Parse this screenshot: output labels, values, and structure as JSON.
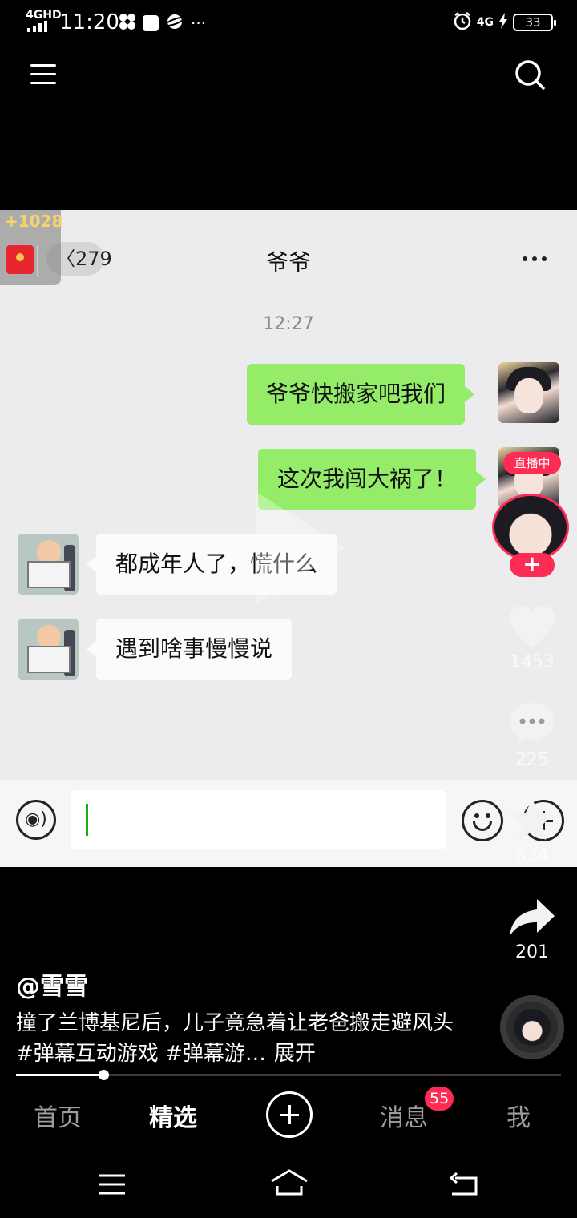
{
  "status_bar": {
    "network": "4GHD",
    "time": "11:20",
    "network_right": "4G",
    "battery": "33",
    "icons": [
      "signal-icon",
      "pinwheel-icon",
      "square-icon",
      "planet-icon",
      "more-dots-icon",
      "alarm-icon",
      "charging-icon",
      "battery-icon"
    ]
  },
  "top_nav": {
    "menu_icon": "menu-icon",
    "search_icon": "search-icon"
  },
  "video": {
    "chat": {
      "back_count": "279",
      "title": "爷爷",
      "time": "12:27",
      "messages": [
        {
          "from": "me",
          "text": "爷爷快搬家吧我们"
        },
        {
          "from": "me",
          "text": "这次我闯大祸了！"
        },
        {
          "from": "other",
          "text": "都成年人了，慌什么"
        },
        {
          "from": "other",
          "text": "遇到啥事慢慢说"
        }
      ]
    }
  },
  "reward": {
    "count": "+1028"
  },
  "rail": {
    "live_badge": "直播中",
    "follow": "+",
    "likes": "1453",
    "comments": "225",
    "favorites": "624",
    "shares": "201"
  },
  "post": {
    "author": "@雪雪",
    "caption": "撞了兰博基尼后，儿子竟急着让老爸搬走避风头 #弹幕互动游戏 #弹幕游…",
    "expand": "展开",
    "progress": 0.16
  },
  "tabbar": {
    "tabs": [
      "首页",
      "精选",
      "消息",
      "我"
    ],
    "messages_badge": "55"
  },
  "colors": {
    "accent": "#fe2c55",
    "wechat_green": "#95ec69",
    "chat_bg": "#ececee"
  }
}
